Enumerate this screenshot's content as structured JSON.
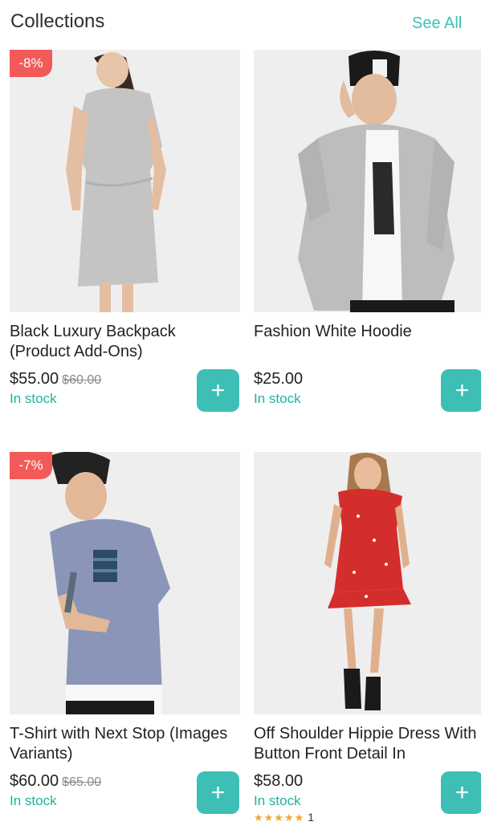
{
  "header": {
    "title": "Collections",
    "see_all_label": "See All"
  },
  "products": [
    {
      "name": "Black Luxury Backpack (Product Add-Ons)",
      "price": "$55.00",
      "old_price": "$60.00",
      "stock": "In stock",
      "badge": "-8%",
      "add_label": "+"
    },
    {
      "name": "Fashion White Hoodie",
      "price": "$25.00",
      "stock": "In stock",
      "add_label": "+"
    },
    {
      "name": "T-Shirt with Next Stop (Images Variants)",
      "price": "$60.00",
      "old_price": "$65.00",
      "stock": "In stock",
      "badge": "-7%",
      "add_label": "+"
    },
    {
      "name": "Off Shoulder Hippie Dress With Button Front Detail In",
      "price": "$58.00",
      "stock": "In stock",
      "add_label": "+",
      "rating_stars": "★★★★★",
      "rating_count": "1"
    }
  ],
  "colors": {
    "accent": "#3dbfb6",
    "stock_text": "#20b29f",
    "badge": "#f25a5a",
    "star": "#f4a62a"
  }
}
